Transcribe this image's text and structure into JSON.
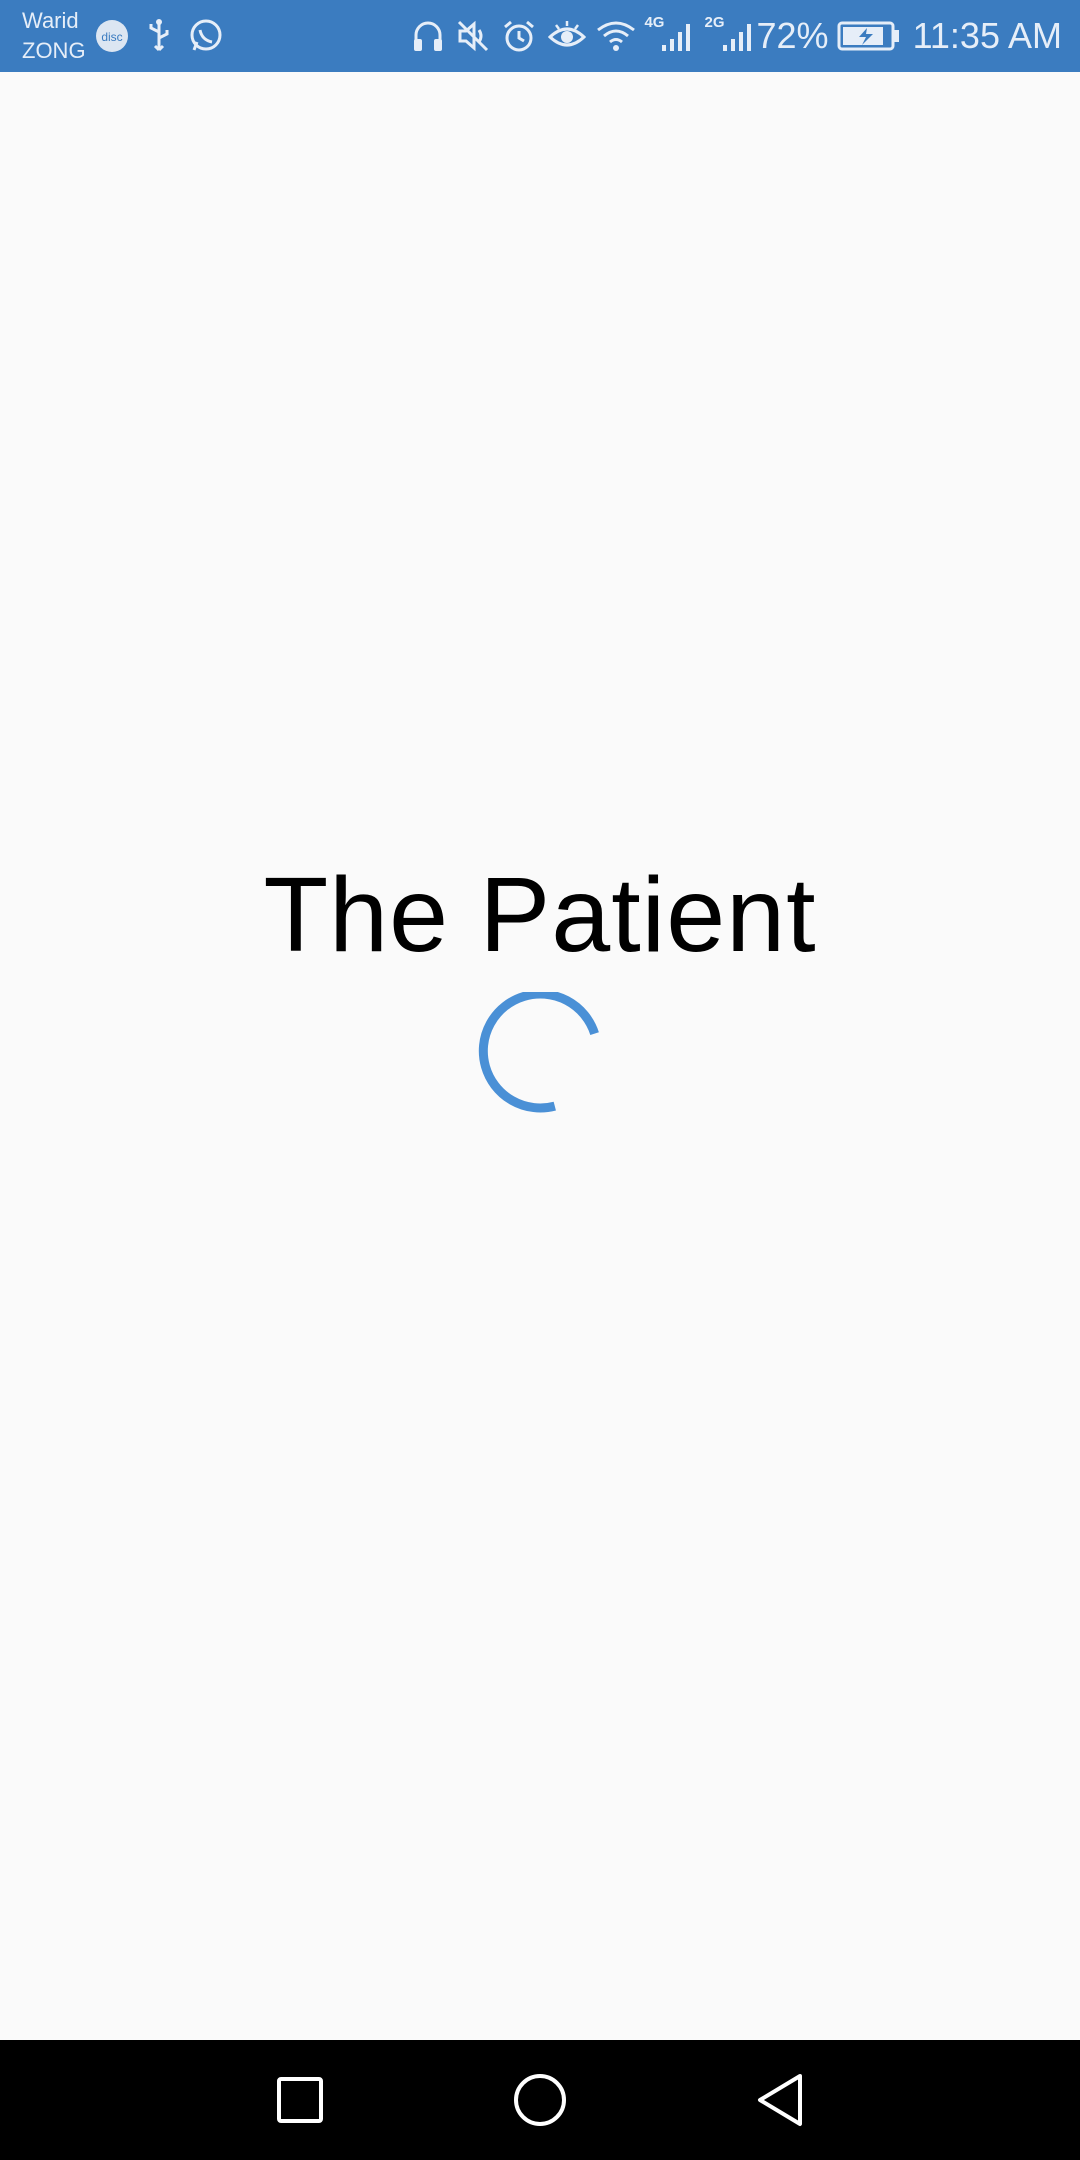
{
  "status_bar": {
    "carrier_1": "Warid",
    "carrier_2": "ZONG",
    "left_icons": [
      "disc-icon",
      "usb-icon",
      "whatsapp-icon"
    ],
    "right_icons": [
      "headphones-icon",
      "mute-icon",
      "alarm-icon",
      "eye-icon",
      "wifi-icon",
      "signal-4g-icon",
      "signal-2g-icon",
      "battery-charging-icon"
    ],
    "network_1": "4G",
    "network_2": "2G",
    "battery_percent": "72%",
    "time": "11:35 AM",
    "background_color": "#3b7cc0"
  },
  "splash": {
    "title": "The Patient",
    "spinner_color": "#4a90d6"
  },
  "nav_bar": {
    "buttons": [
      "recents-button",
      "home-button",
      "back-button"
    ]
  }
}
